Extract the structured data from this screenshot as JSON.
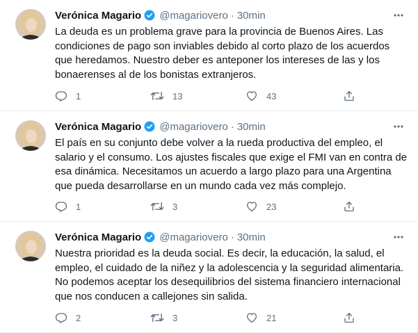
{
  "colors": {
    "name": "#0f1419",
    "secondary": "#5b7083",
    "verified": "#1da1f2",
    "divider": "#e6ecf0"
  },
  "icons": {
    "reply": "reply-icon",
    "retweet": "retweet-icon",
    "like": "heart-icon",
    "share": "share-icon",
    "more": "more-icon",
    "verified": "verified-badge-icon"
  },
  "tweets": [
    {
      "name": "Verónica Magario",
      "handle": "@magariovero",
      "separator": "·",
      "time": "30min",
      "text_lines": [
        "La deuda es un problema grave para la provincia de Buenos Aires. Las",
        "condiciones de pago son inviables debido al corto plazo de los acuerdos",
        "que heredamos. Nuestro deber es anteponer los intereses de las y los",
        "bonaerenses al de los bonistas extranjeros."
      ],
      "replies": "1",
      "retweets": "13",
      "likes": "43"
    },
    {
      "name": "Verónica Magario",
      "handle": "@magariovero",
      "separator": "·",
      "time": "30min",
      "text_lines": [
        "El país en su conjunto debe volver a la rueda productiva del empleo, el",
        "salario y el consumo. Los ajustes fiscales que exige el FMI van en contra de",
        "esa dinámica. Necesitamos un acuerdo a largo plazo para una Argentina",
        "que pueda desarrollarse en un mundo cada vez más complejo."
      ],
      "replies": "1",
      "retweets": "3",
      "likes": "23"
    },
    {
      "name": "Verónica Magario",
      "handle": "@magariovero",
      "separator": "·",
      "time": "30min",
      "text_lines": [
        "Nuestra prioridad es la deuda social. Es decir, la educación, la salud, el",
        "empleo, el cuidado de la niñez y la adolescencia y la seguridad alimentaria.",
        "No podemos aceptar los desequilibrios del sistema financiero internacional",
        "que nos conducen a callejones sin salida."
      ],
      "replies": "2",
      "retweets": "3",
      "likes": "21"
    }
  ]
}
